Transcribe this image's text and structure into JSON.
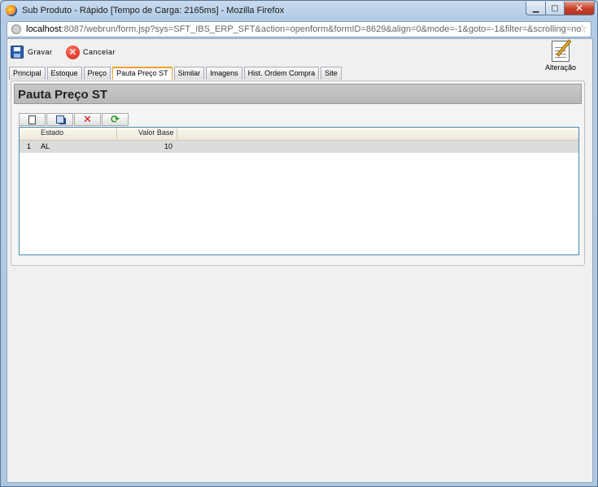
{
  "window": {
    "title": "Sub Produto - Rápido [Tempo de Carga: 2165ms] - Mozilla Firefox",
    "url_host": "localhost",
    "url_rest": ":8087/webrun/form.jsp?sys=SFT_IBS_ERP_SFT&action=openform&formID=8629&align=0&mode=-1&goto=-1&filter=&scrolling=no"
  },
  "toolbar": {
    "save_label": "Gravar",
    "cancel_label": "Cancelar",
    "alteracao_label": "Alteração"
  },
  "tabs": [
    {
      "label": "Principal"
    },
    {
      "label": "Estoque"
    },
    {
      "label": "Preço"
    },
    {
      "label": "Pauta Preço ST",
      "active": true
    },
    {
      "label": "Similar"
    },
    {
      "label": "Imagens"
    },
    {
      "label": "Hist. Ordem Compra"
    },
    {
      "label": "Site"
    }
  ],
  "panel": {
    "title": "Pauta Preço ST"
  },
  "grid": {
    "columns": [
      "Estado",
      "Valor Base"
    ],
    "rows": [
      {
        "num": "1",
        "estado": "AL",
        "valor_base": "10"
      }
    ]
  }
}
